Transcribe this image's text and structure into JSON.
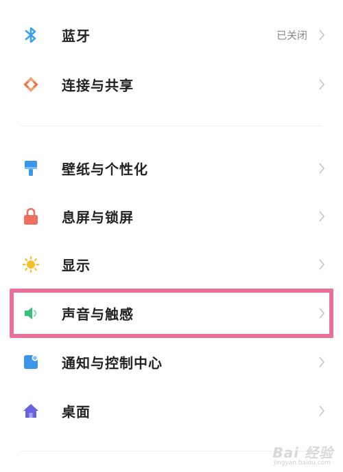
{
  "rows": [
    {
      "label": "蓝牙",
      "status": "已关闭",
      "icon": "bluetooth-icon",
      "color": "#3aa0e8"
    },
    {
      "label": "连接与共享",
      "icon": "connection-share-icon",
      "color": "#e5723f"
    },
    {
      "label": "壁纸与个性化",
      "icon": "paint-brush-icon",
      "color": "#3b95e8"
    },
    {
      "label": "息屏与锁屏",
      "icon": "lock-icon",
      "color": "#ef6f5e"
    },
    {
      "label": "显示",
      "icon": "sun-icon",
      "color": "#f6c02b"
    },
    {
      "label": "声音与触感",
      "icon": "speaker-icon",
      "color": "#36c37b"
    },
    {
      "label": "通知与控制中心",
      "icon": "notification-icon",
      "color": "#3b95e8"
    },
    {
      "label": "桌面",
      "icon": "home-icon",
      "color": "#6a63e0"
    }
  ],
  "watermark": {
    "main": "Bai 经验",
    "sub": "jingyan.baidu.com"
  },
  "colors": {
    "highlight": "#e9709a",
    "text": "#222222",
    "status": "#8a8a8a",
    "chevron": "#c4c4c4"
  }
}
